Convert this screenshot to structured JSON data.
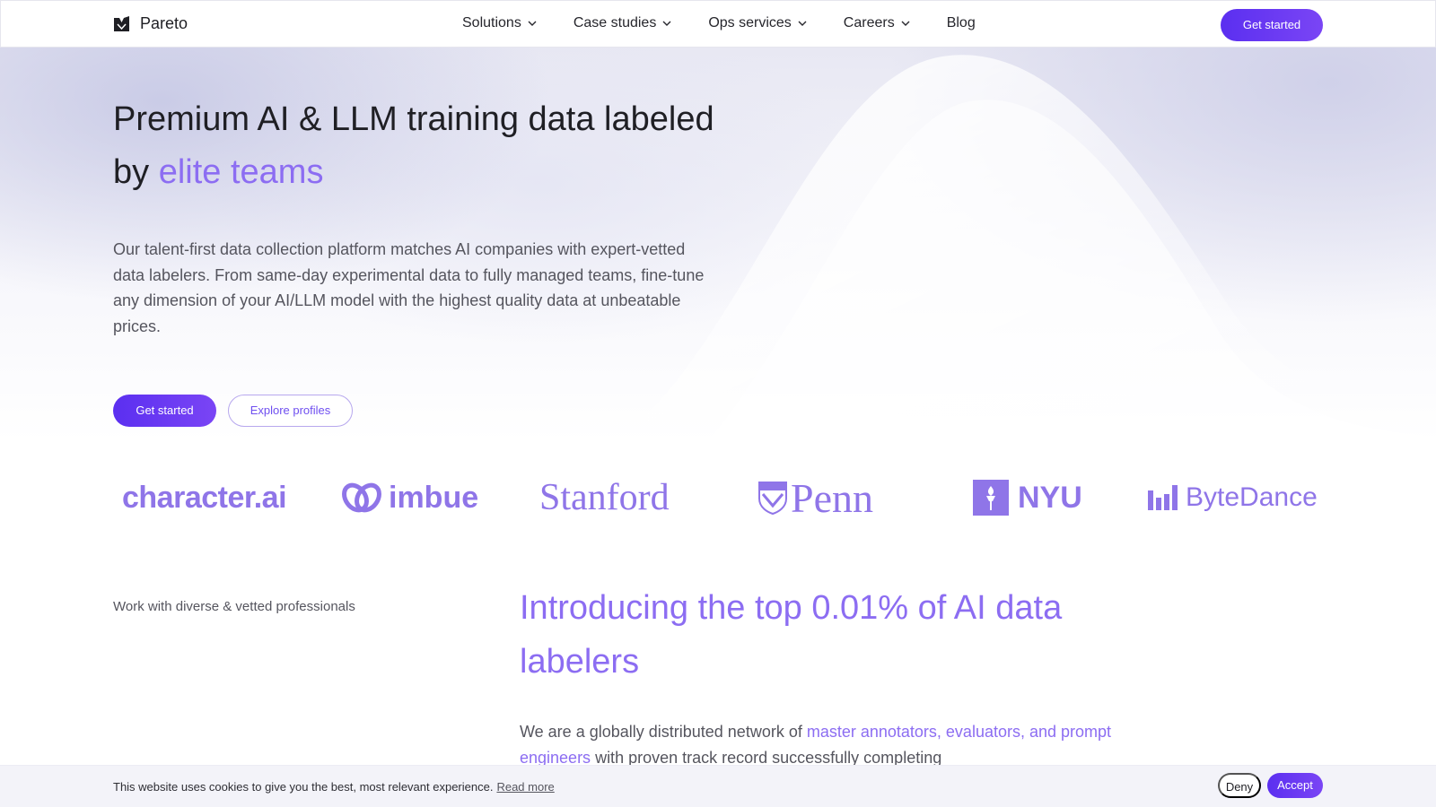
{
  "header": {
    "brand": "Pareto",
    "nav": [
      {
        "label": "Solutions",
        "has_dropdown": true
      },
      {
        "label": "Case studies",
        "has_dropdown": true
      },
      {
        "label": "Ops services",
        "has_dropdown": true
      },
      {
        "label": "Careers",
        "has_dropdown": true
      },
      {
        "label": "Blog",
        "has_dropdown": false
      }
    ],
    "cta": "Get started"
  },
  "hero": {
    "title_main": "Premium AI & LLM training data labeled by ",
    "title_accent": "elite teams",
    "description": "Our talent-first data collection platform matches AI companies with expert-vetted data labelers. From same-day experimental data to fully managed teams, fine-tune any dimension of your AI/LLM model with the highest quality data at unbeatable prices.",
    "primary_cta": "Get started",
    "secondary_cta": "Explore profiles"
  },
  "logos": {
    "character": "character.ai",
    "imbue": "imbue",
    "stanford": "Stanford",
    "penn": "Penn",
    "nyu": "NYU",
    "bytedance": "ByteDance"
  },
  "section": {
    "eyebrow": "Work with diverse & vetted professionals",
    "title": "Introducing the top 0.01% of AI data labelers",
    "body_start": "We are a globally distributed network of ",
    "body_accent": "master annotators, evaluators, and prompt engineers",
    "body_end": " with proven track record successfully completing"
  },
  "cookie": {
    "text": "This website uses cookies to give you the best, most relevant experience.",
    "link": "Read more",
    "deny": "Deny",
    "accept": "Accept"
  },
  "colors": {
    "accent": "#8c6df2",
    "primary_button": "#5b2ff0",
    "text": "#1f1f24",
    "muted_text": "#55555e"
  }
}
